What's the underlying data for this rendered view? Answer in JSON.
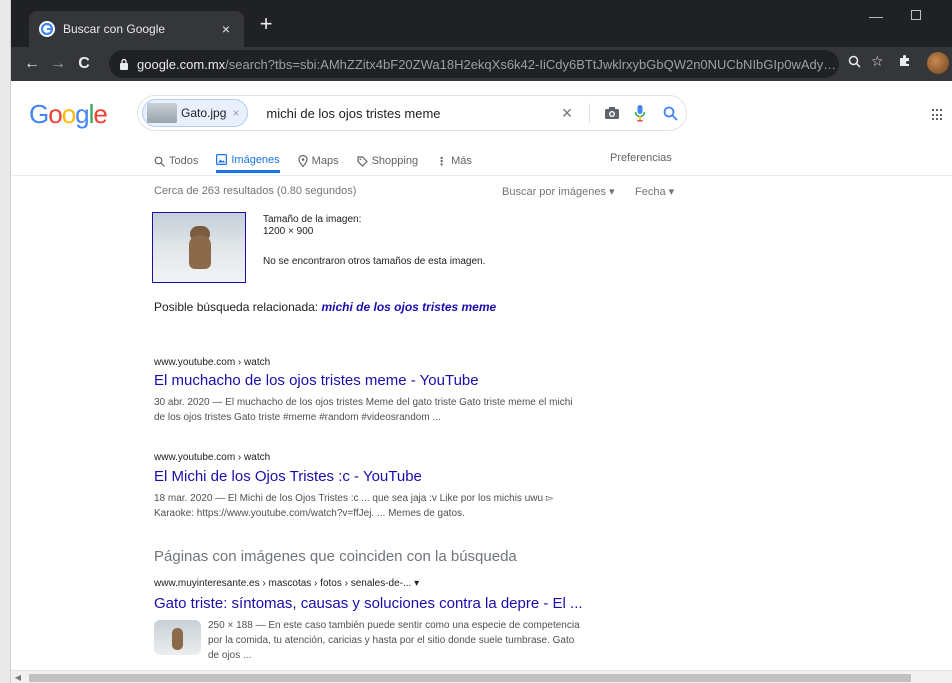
{
  "browser": {
    "tab_title": "Buscar con Google",
    "tab_close": "×",
    "new_tab": "+",
    "url_domain": "google.com.mx",
    "url_path": "/search?tbs=sbi:AMhZZitx4bF20ZWa18H2ekqXs6k42-IiCdy6BTtJwklrxybGbQW2n0NUCbNIbGIp0wAdy6Qlqy...",
    "nav_back": "←",
    "nav_forward": "→",
    "nav_reload": "C"
  },
  "search": {
    "logo": [
      "G",
      "o",
      "o",
      "g",
      "l",
      "e"
    ],
    "logo_colors": [
      "#4285f4",
      "#ea4335",
      "#fbbc05",
      "#4285f4",
      "#34a853",
      "#ea4335"
    ],
    "chip_label": "Gato.jpg",
    "chip_close": "×",
    "query": "michi de los ojos tristes meme",
    "clear": "×"
  },
  "tabs": {
    "todos": "Todos",
    "imagenes": "Imágenes",
    "maps": "Maps",
    "shopping": "Shopping",
    "mas": "Más",
    "preferencias": "Preferencias"
  },
  "results_meta": {
    "stats": "Cerca de 263 resultados (0.80 segundos)",
    "buscar_por_imagenes": "Buscar por imágenes ▾",
    "fecha": "Fecha ▾"
  },
  "query_image": {
    "size_label": "Tamaño de la imagen:",
    "size_value": "1200 × 900",
    "no_other": "No se encontraron otros tamaños de esta imagen."
  },
  "related": {
    "prefix": "Posible búsqueda relacionada: ",
    "link": "michi de los ojos tristes meme"
  },
  "results": [
    {
      "cite": "www.youtube.com › watch",
      "title": "El muchacho de los ojos tristes meme - YouTube",
      "snippet_line1": "30 abr. 2020 — El muchacho de los ojos tristes Meme del gato triste Gato triste meme el michi",
      "snippet_line2": "de los ojos tristes Gato triste #meme #random #videosrandom ..."
    },
    {
      "cite": "www.youtube.com › watch",
      "title": "El Michi de los Ojos Tristes :c - YouTube",
      "snippet_line1": "18 mar. 2020 — El Michi de los Ojos Tristes :c ... que sea jaja :v Like por los michis uwu ▻",
      "snippet_line2": "Karaoke: https://www.youtube.com/watch?v=ffJej. ... Memes de gatos."
    }
  ],
  "matching_pages": {
    "heading": "Páginas con imágenes que coinciden con la búsqueda",
    "cite": "www.muyinteresante.es › mascotas › fotos › senales-de-... ▾",
    "title": "Gato triste: síntomas, causas y soluciones contra la depre - El ...",
    "snippet_line1": "250 × 188 — En este caso también puede sentir como una especie de competencia",
    "snippet_line2": "por la comida, tu atención, caricias y hasta por el sitio donde suele tumbrase. Gato",
    "snippet_line3": "de ojos ..."
  }
}
